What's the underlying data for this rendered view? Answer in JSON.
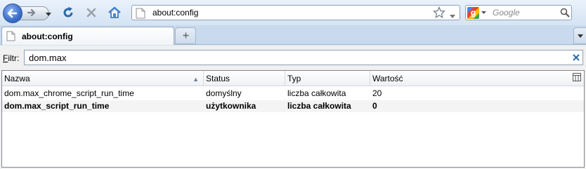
{
  "navbar": {
    "url": "about:config",
    "search_placeholder": "Google"
  },
  "tabs": [
    {
      "title": "about:config"
    }
  ],
  "filter": {
    "label_accel": "F",
    "label_rest": "iltr:",
    "value": "dom.max"
  },
  "table": {
    "columns": [
      "Nazwa",
      "Status",
      "Typ",
      "Wartość"
    ],
    "rows": [
      {
        "name": "dom.max_chrome_script_run_time",
        "status": "domyślny",
        "type": "liczba całkowita",
        "value": "20",
        "modified": false
      },
      {
        "name": "dom.max_script_run_time",
        "status": "użytkownika",
        "type": "liczba całkowita",
        "value": "0",
        "modified": true
      }
    ]
  },
  "colors": {
    "accent": "#3c6fcc",
    "reload": "#2b6aa8",
    "home": "#3f7ac8"
  }
}
